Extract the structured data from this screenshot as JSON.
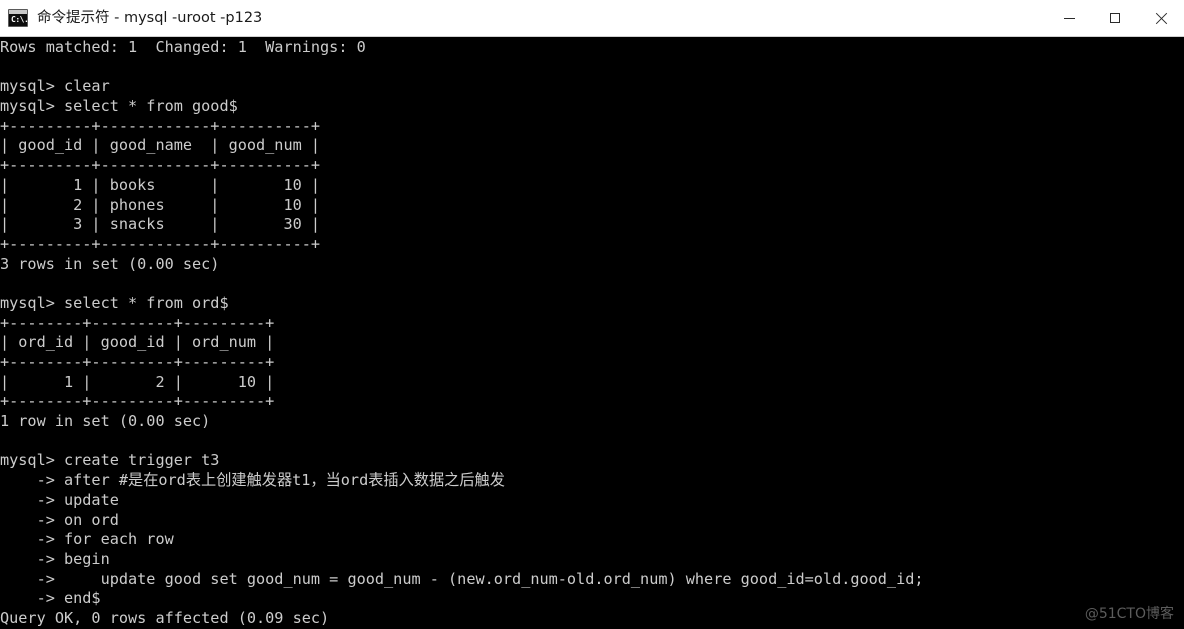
{
  "window": {
    "title": "命令提示符 - mysql  -uroot -p123",
    "icon_glyph": "C:\\.",
    "icon_name": "cmd-icon",
    "background": "#000000",
    "titlebar_background": "#ffffff",
    "text_color": "#cccccc"
  },
  "controls": {
    "minimize_label": "Minimize",
    "maximize_label": "Maximize",
    "close_label": "Close"
  },
  "terminal": {
    "prompt": "mysql>",
    "continuation_prompt": "->",
    "lines": [
      "Rows matched: 1  Changed: 1  Warnings: 0",
      "",
      "mysql> clear",
      "mysql> select * from good$",
      "+---------+------------+----------+",
      "| good_id | good_name  | good_num |",
      "+---------+------------+----------+",
      "|       1 | books      |       10 |",
      "|       2 | phones     |       10 |",
      "|       3 | snacks     |       30 |",
      "+---------+------------+----------+",
      "3 rows in set (0.00 sec)",
      "",
      "mysql> select * from ord$",
      "+--------+---------+---------+",
      "| ord_id | good_id | ord_num |",
      "+--------+---------+---------+",
      "|      1 |       2 |      10 |",
      "+--------+---------+---------+",
      "1 row in set (0.00 sec)",
      "",
      "mysql> create trigger t3",
      "    -> after #是在ord表上创建触发器t1，当ord表插入数据之后触发",
      "    -> update",
      "    -> on ord",
      "    -> for each row",
      "    -> begin",
      "    ->     update good set good_num = good_num - (new.ord_num-old.ord_num) where good_id=old.good_id;",
      "    -> end$",
      "Query OK, 0 rows affected (0.09 sec)"
    ]
  },
  "tables": [
    {
      "name": "good",
      "query": "select * from good$",
      "columns": [
        "good_id",
        "good_name",
        "good_num"
      ],
      "rows": [
        [
          "1",
          "books",
          "10"
        ],
        [
          "2",
          "phones",
          "10"
        ],
        [
          "3",
          "snacks",
          "30"
        ]
      ],
      "status": "3 rows in set (0.00 sec)"
    },
    {
      "name": "ord",
      "query": "select * from ord$",
      "columns": [
        "ord_id",
        "good_id",
        "ord_num"
      ],
      "rows": [
        [
          "1",
          "2",
          "10"
        ]
      ],
      "status": "1 row in set (0.00 sec)"
    }
  ],
  "trigger": {
    "name": "t3",
    "comment": "#是在ord表上创建触发器t1，当ord表插入数据之后触发",
    "timing": "after",
    "event": "update",
    "table": "ord",
    "scope": "for each row",
    "body": "update good set good_num = good_num - (new.ord_num-old.ord_num) where good_id=old.good_id;",
    "result": "Query OK, 0 rows affected (0.09 sec)"
  },
  "watermark": {
    "text": "@51CTO博客"
  }
}
